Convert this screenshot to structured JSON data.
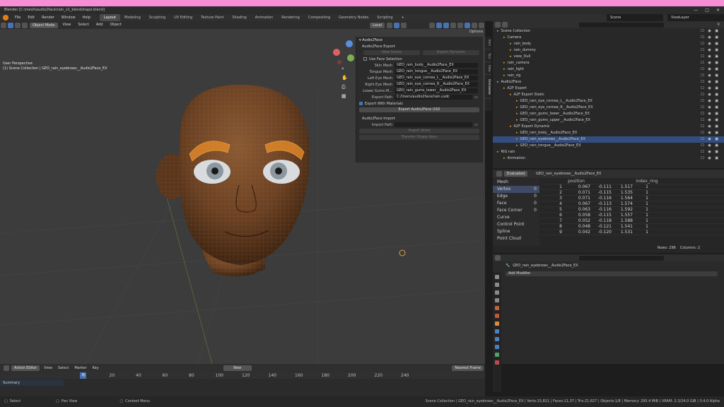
{
  "window": {
    "title": "Blender [C:\\mesh\\audio2face\\rain_v1_blendshape.blend]",
    "controls": [
      "—",
      "□",
      "✕"
    ]
  },
  "menubar": {
    "menus": [
      "File",
      "Edit",
      "Render",
      "Window",
      "Help"
    ],
    "workspaces": [
      "Layout",
      "Modeling",
      "Sculpting",
      "UV Editing",
      "Texture Paint",
      "Shading",
      "Animation",
      "Rendering",
      "Compositing",
      "Geometry Nodes",
      "Scripting"
    ],
    "active_workspace": "Layout",
    "scene": "Scene",
    "view_layer": "ViewLayer"
  },
  "viewport": {
    "mode": "Object Mode",
    "menus": [
      "View",
      "Select",
      "Add",
      "Object"
    ],
    "transform": "Local",
    "options": "Options",
    "info_line1": "User Perspective",
    "info_line2": "(1) Scene Collection | GEO_rain_eyebrows__Audio2Face_EX"
  },
  "npanel": {
    "tabs": [
      "Item",
      "Tool",
      "View",
      "Omniverse"
    ],
    "header": "Audio2Face",
    "export_section": "Audio2Face Export",
    "btn_new_scene": "New Scene",
    "btn_export_dynamic": "Export Dynamic",
    "use_face_selection": "Use Face Selection",
    "fields": [
      {
        "label": "Skin Mesh",
        "value": "GEO_rain_body__Audio2Face_EX"
      },
      {
        "label": "Tongue Mesh",
        "value": "GEO_rain_tongue__Audio2Face_EX"
      },
      {
        "label": "Left Eye Mesh",
        "value": "GEO_rain_eye_cornea_L__Audio2Face_EX"
      },
      {
        "label": "Right Eye Mesh",
        "value": "GEO_rain_eye_cornea_R__Audio2Face_EX"
      },
      {
        "label": "Lower Gums M...",
        "value": "GEO_rain_gums_lower__Audio2Face_EX"
      }
    ],
    "export_path_label": "Export Path",
    "export_path": "C:/Users/audio2face/rain.usdc",
    "export_with_materials": "Export With Materials",
    "btn_export_usd": "Export Audio2Face USD",
    "import_section": "Audio2Face Import",
    "import_path_label": "Import Path",
    "btn_import": "Import Anim",
    "btn_transfer": "Transfer Shape Keys"
  },
  "outliner": {
    "search_placeholder": "",
    "rows": [
      {
        "indent": 0,
        "name": "Scene Collection",
        "sel": false
      },
      {
        "indent": 1,
        "name": "Camera",
        "sel": false
      },
      {
        "indent": 2,
        "name": "rain_body",
        "sel": false
      },
      {
        "indent": 2,
        "name": "rain_dummy",
        "sel": false
      },
      {
        "indent": 2,
        "name": "view_Dull",
        "sel": false
      },
      {
        "indent": 1,
        "name": "rain_camera",
        "sel": false
      },
      {
        "indent": 1,
        "name": "rain_light",
        "sel": false
      },
      {
        "indent": 1,
        "name": "rain_rig",
        "sel": false
      },
      {
        "indent": 0,
        "name": "Audio2Face",
        "sel": false
      },
      {
        "indent": 1,
        "name": "A2F Export",
        "sel": false
      },
      {
        "indent": 2,
        "name": "A2F Export Static",
        "sel": false
      },
      {
        "indent": 3,
        "name": "GEO_rain_eye_cornea_L__Audio2Face_EX",
        "sel": false
      },
      {
        "indent": 3,
        "name": "GEO_rain_eye_cornea_R__Audio2Face_EX",
        "sel": false
      },
      {
        "indent": 3,
        "name": "GEO_rain_gums_lower__Audio2Face_EX",
        "sel": false
      },
      {
        "indent": 3,
        "name": "GEO_rain_gums_upper__Audio2Face_EX",
        "sel": false
      },
      {
        "indent": 2,
        "name": "A2F Export Dynamic",
        "sel": false
      },
      {
        "indent": 3,
        "name": "GEO_rain_body__Audio2Face_EX",
        "sel": false
      },
      {
        "indent": 3,
        "name": "GEO_rain_eyebrows__Audio2Face_EX",
        "sel": true
      },
      {
        "indent": 3,
        "name": "GEO_rain_tongue__Audio2Face_EX",
        "sel": false
      },
      {
        "indent": 0,
        "name": "RIG rain",
        "sel": false
      },
      {
        "indent": 1,
        "name": "Animation",
        "sel": false
      }
    ]
  },
  "spreadsheet": {
    "mode": "Evaluated",
    "object": "GEO_rain_eyebrows__Audio2Face_EX",
    "left_items": [
      {
        "name": "Mesh",
        "count": "",
        "sel": false
      },
      {
        "name": "Vertex",
        "count": "0",
        "sel": true
      },
      {
        "name": "Edge",
        "count": "0",
        "sel": false
      },
      {
        "name": "Face",
        "count": "0",
        "sel": false
      },
      {
        "name": "Face Corner",
        "count": "0",
        "sel": false
      },
      {
        "name": "Curve",
        "count": "",
        "sel": false
      },
      {
        "name": "Control Point",
        "count": "",
        "sel": false
      },
      {
        "name": "Spline",
        "count": "",
        "sel": false
      },
      {
        "name": "Point Cloud",
        "count": "",
        "sel": false
      }
    ],
    "columns": [
      "",
      "position",
      "",
      "",
      "index_ring"
    ],
    "rows": [
      [
        "1",
        "0.067",
        "-0.111",
        "1.517",
        "1"
      ],
      [
        "2",
        "0.071",
        "-0.115",
        "1.535",
        "1"
      ],
      [
        "3",
        "0.071",
        "-0.116",
        "1.564",
        "1"
      ],
      [
        "4",
        "0.067",
        "-0.113",
        "1.574",
        "1"
      ],
      [
        "5",
        "0.063",
        "-0.116",
        "1.592",
        "1"
      ],
      [
        "6",
        "0.058",
        "-0.115",
        "1.557",
        "1"
      ],
      [
        "7",
        "0.052",
        "-0.118",
        "1.588",
        "1"
      ],
      [
        "8",
        "0.048",
        "-0.121",
        "1.541",
        "1"
      ],
      [
        "9",
        "0.042",
        "-0.120",
        "1.531",
        "1"
      ]
    ],
    "footer_rows": "Rows: 296",
    "footer_cols": "Columns: 2"
  },
  "properties": {
    "object": "GEO_rain_eyebrows__Audio2Face_EX",
    "add_modifier": "Add Modifier"
  },
  "timeline": {
    "editor": "Action Editor",
    "menus": [
      "View",
      "Select",
      "Marker",
      "Key"
    ],
    "action_btn": "New",
    "summary": "Summary",
    "nearest_frame": "Nearest Frame",
    "ticks": [
      "0",
      "20",
      "40",
      "60",
      "80",
      "100",
      "120",
      "140",
      "160",
      "180",
      "200",
      "220",
      "240"
    ],
    "current_frame": "0"
  },
  "statusbar": {
    "left": "Select",
    "middle": "Pan View",
    "right_action": "Context Menu",
    "stats": "Scene Collection | GEO_rain_eyebrows__Audio2Face_EX | Verts:15,811 | Faces:11,37 | Tris:21,827 | Objects:1/8 | Memory: 295.4 MiB | VRAM: 2.3/24.0 GiB | 3.4.0 Alpha"
  },
  "colors": {
    "accent": "#4772b3",
    "selection": "#334d80",
    "orange": "#e87d0d",
    "pink_bar": "#f58ed5"
  }
}
